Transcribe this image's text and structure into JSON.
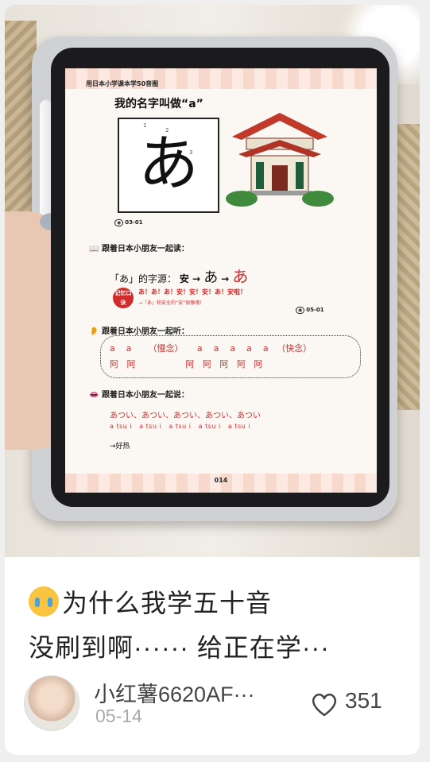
{
  "screen": {
    "header": "用日本小学课本学50音图",
    "name_title": "我的名字叫做“a”",
    "kana": "あ",
    "stroke_numbers": [
      "1",
      "2",
      "3"
    ],
    "badge_1": "03-01",
    "read_title": "跟着日本小朋友一起读：",
    "origin_prefix": "「あ」的字源：",
    "origin_chain": "安 → ",
    "origin_cursive": "あ",
    "origin_arrow": "→ ",
    "origin_final": "あ",
    "memo_label": "记忆口诀",
    "memo_text": "あ！あ！あ！安！安！安！あ！安啦！",
    "memo_sub": "→「あ」和安全的“安”很像哦！",
    "badge_2": "05-01",
    "listen_title": "跟着日本小朋友一起听：",
    "listen_row1": "a    a      （慢念）     a    a    a    a    a   （快念）",
    "listen_row2": "阿   阿                  阿   阿   阿   阿   阿",
    "speak_title": "跟着日本小朋友一起说：",
    "speak_row1": "あつい、あつい、あつい、あつい、あつい",
    "speak_row2": "a tsu i   a tsu i   a tsu i   a tsu i   a tsu i",
    "speak_meaning": "→好热",
    "page_number": "014"
  },
  "post": {
    "emoji": "crying-face-icon",
    "title_line1": "为什么我学五十音",
    "title_line2": "没刷到啊······ 给正在学···",
    "username": "小红薯6620AF···",
    "date": "05-14",
    "likes": "351",
    "like_icon": "heart-outline-icon"
  }
}
